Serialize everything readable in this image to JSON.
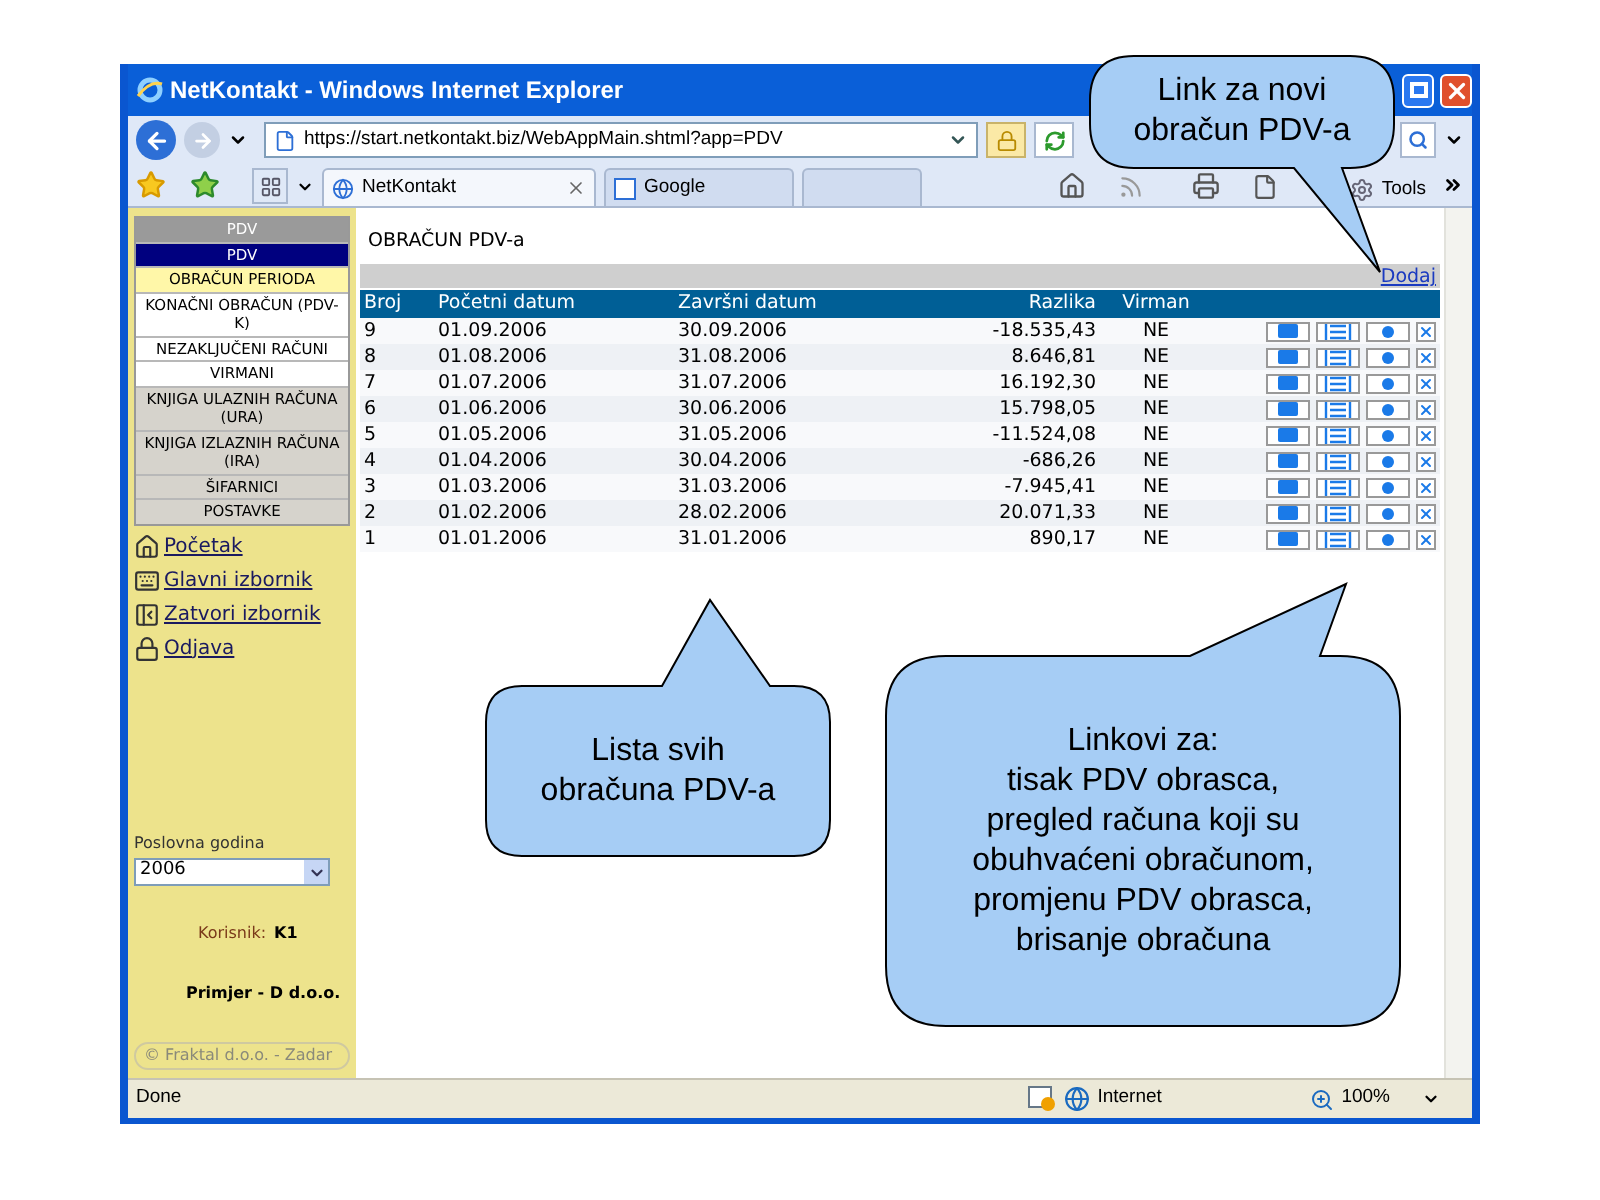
{
  "window": {
    "title": "NetKontakt - Windows Internet Explorer"
  },
  "address_bar": {
    "url": "https://start.netkontakt.biz/WebAppMain.shtml?app=PDV"
  },
  "tabs": [
    {
      "label": "NetKontakt",
      "selected": true
    },
    {
      "label": "Google",
      "selected": false
    }
  ],
  "toolbar": {
    "tools": "Tools"
  },
  "sidebar": {
    "menu": [
      {
        "label": "PDV",
        "kind": "heading"
      },
      {
        "label": "PDV",
        "kind": "section",
        "selected": true
      },
      {
        "label": "OBRAČUN PERIODA",
        "kind": "sub",
        "selected": true
      },
      {
        "label": "KONAČNI OBRAČUN (PDV-K)",
        "kind": "sub",
        "selected": false
      },
      {
        "label": "NEZAKLJUČENI RAČUNI",
        "kind": "sub",
        "selected": false
      },
      {
        "label": "VIRMANI",
        "kind": "sub",
        "selected": false
      },
      {
        "label": "KNJIGA ULAZNIH RAČUNA (URA)",
        "kind": "section",
        "selected": false
      },
      {
        "label": "KNJIGA IZLAZNIH RAČUNA (IRA)",
        "kind": "section",
        "selected": false
      },
      {
        "label": "ŠIFARNICI",
        "kind": "section",
        "selected": false
      },
      {
        "label": "POSTAVKE",
        "kind": "section",
        "selected": false
      }
    ],
    "links": [
      "Početak",
      "Glavni izbornik",
      "Zatvori izbornik",
      "Odjava"
    ],
    "year_label": "Poslovna godina",
    "year": "2006",
    "user_label": "Korisnik:",
    "user": "K1",
    "company": "Primjer - D d.o.o.",
    "copyright": "© Fraktal d.o.o. - Zadar"
  },
  "page": {
    "title": "OBRAČUN PDV-a",
    "add_link": "Dodaj"
  },
  "table": {
    "columns": [
      "Broj",
      "Početni datum",
      "Završni datum",
      "Razlika",
      "Virman"
    ],
    "rows": [
      [
        "9",
        "01.09.2006",
        "30.09.2006",
        "-18.535,43",
        "NE"
      ],
      [
        "8",
        "01.08.2006",
        "31.08.2006",
        "8.646,81",
        "NE"
      ],
      [
        "7",
        "01.07.2006",
        "31.07.2006",
        "16.192,30",
        "NE"
      ],
      [
        "6",
        "01.06.2006",
        "30.06.2006",
        "15.798,05",
        "NE"
      ],
      [
        "5",
        "01.05.2006",
        "31.05.2006",
        "-11.524,08",
        "NE"
      ],
      [
        "4",
        "01.04.2006",
        "30.04.2006",
        "-686,26",
        "NE"
      ],
      [
        "3",
        "01.03.2006",
        "31.03.2006",
        "-7.945,41",
        "NE"
      ],
      [
        "2",
        "01.02.2006",
        "28.02.2006",
        "20.071,33",
        "NE"
      ],
      [
        "1",
        "01.01.2006",
        "31.01.2006",
        "890,17",
        "NE"
      ]
    ]
  },
  "status_bar": {
    "status": "Done",
    "zone": "Internet",
    "zoom": "100%"
  },
  "callouts": [
    {
      "text": "Link za novi\nobračun PDV-a"
    },
    {
      "text": "Lista svih\nobračuna PDV-a"
    },
    {
      "text": "Linkovi za:\ntisak PDV obrasca,\npregled računa koji su\nobuhvaćeni obračunom,\npromjenu PDV obrasca,\nbrisanje obračuna"
    }
  ]
}
